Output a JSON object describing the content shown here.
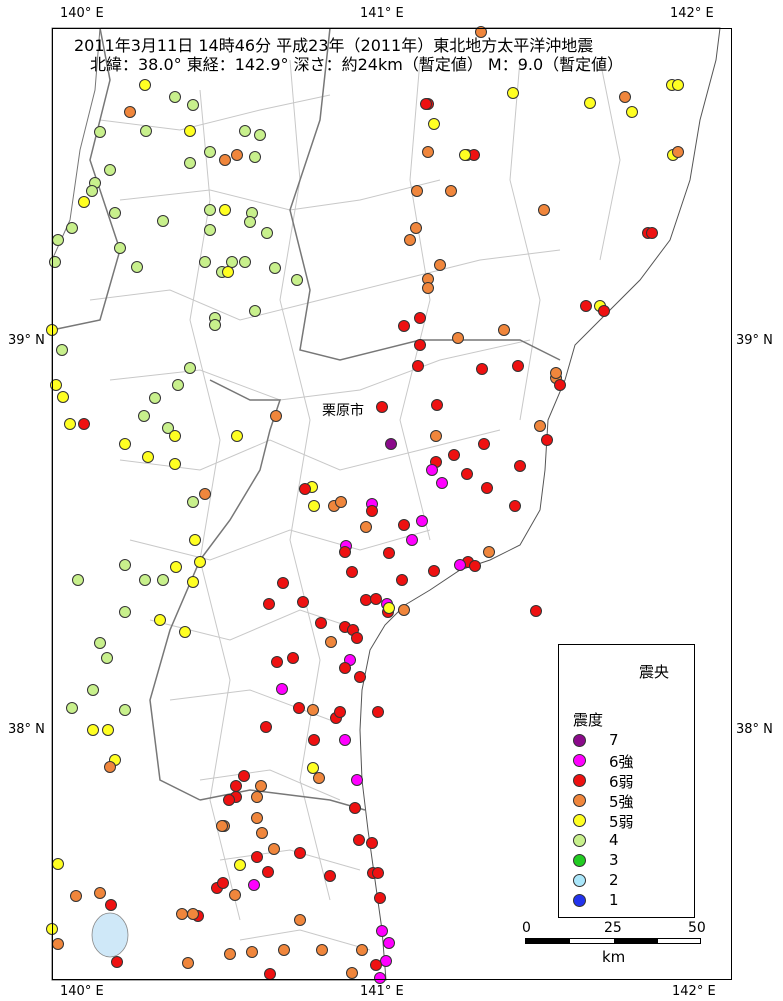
{
  "title": {
    "line1": "2011年3月11日 14時46分 平成23年（2011年）東北地方太平洋沖地震",
    "line2": "北緯：38.0° 東経：142.9° 深さ：約24km（暫定値） M：9.0（暫定値）"
  },
  "axis": {
    "lon_labels": [
      "140° E",
      "141° E",
      "142° E"
    ],
    "lat_labels": [
      "39° N",
      "38° N"
    ]
  },
  "place_label": "栗原市",
  "legend": {
    "epicenter_label": "震央",
    "intensity_title": "震度",
    "classes": [
      {
        "label": "7",
        "color": "#8B0A8B"
      },
      {
        "label": "6強",
        "color": "#FF00FF"
      },
      {
        "label": "6弱",
        "color": "#EE1111"
      },
      {
        "label": "5強",
        "color": "#F0863C"
      },
      {
        "label": "5弱",
        "color": "#FFFF22"
      },
      {
        "label": "4",
        "color": "#C8F08C"
      },
      {
        "label": "3",
        "color": "#22CC22"
      },
      {
        "label": "2",
        "color": "#AAE6FA"
      },
      {
        "label": "1",
        "color": "#2233EE"
      }
    ]
  },
  "scale_bar": {
    "ticks": [
      "0",
      "25",
      "50"
    ],
    "unit": "km"
  },
  "colors": {
    "land": "#ffffff",
    "sea": "#ffffff",
    "lake": "#cfe8f8",
    "boundary": "#c8c8c8",
    "pref_boundary": "#777777"
  }
}
